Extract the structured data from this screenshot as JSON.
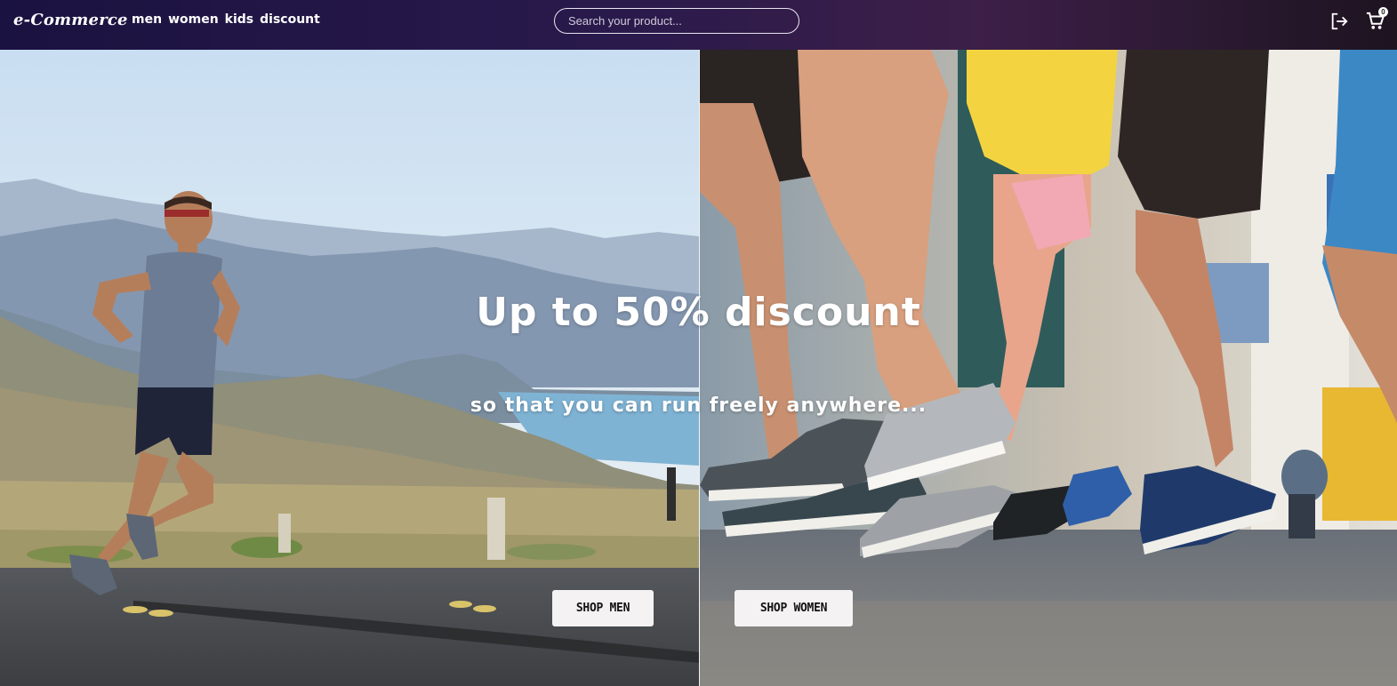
{
  "header": {
    "logo": "e-Commerce",
    "nav": [
      "men",
      "women",
      "kids",
      "discount"
    ],
    "search": {
      "placeholder": "Search your product...",
      "value": ""
    },
    "icons": [
      "logout-icon",
      "cart-icon"
    ],
    "cart_count": "0"
  },
  "hero": {
    "headline": "Up to 50% discount",
    "subline": "so that you can run freely anywhere...",
    "left_button": "SHOP MEN",
    "right_button": "SHOP WOMEN"
  },
  "colors": {
    "nav_gradient_start": "#1a1240",
    "nav_gradient_end": "#3d1f48",
    "button_bg": "#f4f2f2",
    "text_light": "#ffffff"
  }
}
